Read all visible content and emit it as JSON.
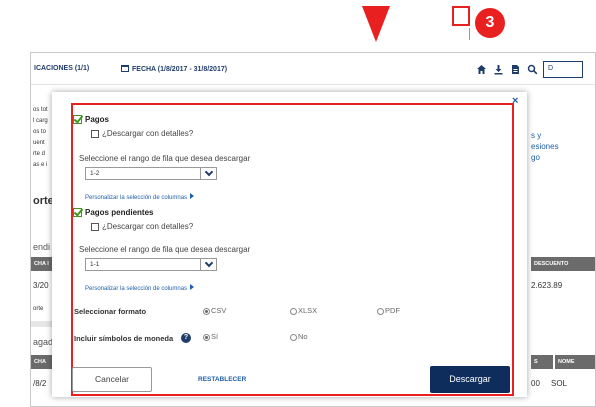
{
  "annotations": {
    "step_number": "3"
  },
  "app": {
    "header": {
      "notifications_label": "ICACIONES (1/1)",
      "date_label": "FECHA (1/8/2017 - 31/8/2017)",
      "button_label": "D"
    },
    "background_fragments": {
      "left_lines": [
        "os tot",
        "l carg",
        "os to",
        "uent",
        "rte d",
        "as e i"
      ],
      "section_title_1": "orte",
      "subtitle_1": "endi",
      "band_1_left": "CHA I",
      "row_1_left": "3/20",
      "row_1_small": "orte",
      "subtitle_2": "agad",
      "band_2_left": "CHA",
      "row_2_left": "/8/2",
      "right_lines": [
        "s y",
        "esiones",
        "go"
      ],
      "band_1_right": "DESCUENTO",
      "row_1_right": "2.623.89",
      "band_2_right_a": "S",
      "band_2_right_b": "NOME",
      "row_2_right_a": "00",
      "row_2_right_b": "SOL"
    }
  },
  "modal": {
    "close_symbol": "×",
    "sections": [
      {
        "label": "Pagos",
        "checked": true,
        "details_label": "¿Descargar con detalles?",
        "range_label": "Seleccione el rango de fila que desea descargar",
        "range_value": "1-2",
        "customize_label": "Personalizar la selección de columnas"
      },
      {
        "label": "Pagos pendientes",
        "checked": true,
        "details_label": "¿Descargar con detalles?",
        "range_label": "Seleccione el rango de fila que desea descargar",
        "range_value": "1-1",
        "customize_label": "Personalizar la selección de columnas"
      }
    ],
    "format": {
      "label": "Seleccionar formato",
      "options": [
        "CSV",
        "XLSX",
        "PDF"
      ],
      "selected": "CSV"
    },
    "currency": {
      "label": "Incluir símbolos de moneda",
      "help": "?",
      "options": [
        "Sí",
        "No"
      ],
      "selected": "Sí"
    },
    "buttons": {
      "cancel": "Cancelar",
      "reset": "RESTABLECER",
      "download": "Descargar"
    }
  },
  "colors": {
    "annotation_red": "#e8201f",
    "primary_navy": "#0f2d5c",
    "link_blue": "#1f5ea8",
    "check_green": "#3d9a1f"
  }
}
